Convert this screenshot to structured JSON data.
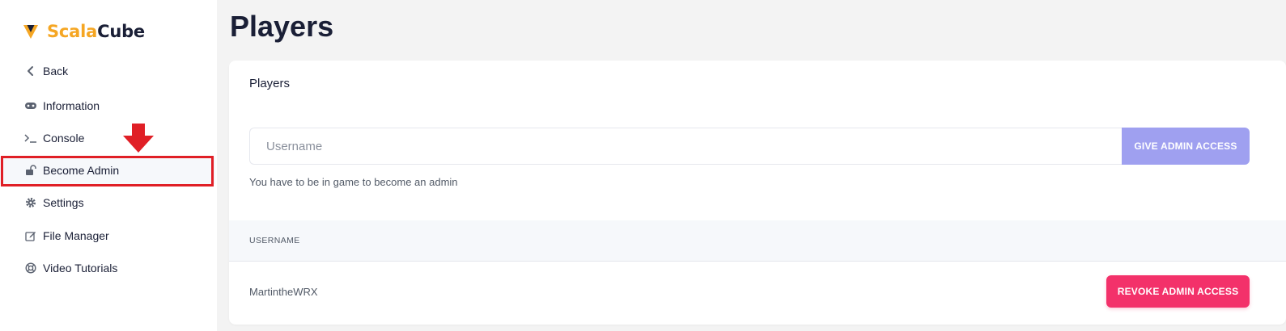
{
  "brand": {
    "part1": "Scala",
    "part2": "Cube",
    "color_scala": "#f5a623",
    "color_cube": "#1a1f36"
  },
  "sidebar": {
    "items": [
      {
        "label": "Back",
        "icon": "chevron-left-icon"
      },
      {
        "label": "Information",
        "icon": "gamepad-icon"
      },
      {
        "label": "Console",
        "icon": "terminal-icon"
      },
      {
        "label": "Become Admin",
        "icon": "unlock-icon"
      },
      {
        "label": "Settings",
        "icon": "gear-icon"
      },
      {
        "label": "File Manager",
        "icon": "edit-icon"
      },
      {
        "label": "Video Tutorials",
        "icon": "lifebuoy-icon"
      }
    ],
    "active_index": 3
  },
  "annotation": {
    "color": "#e01f26"
  },
  "page": {
    "title": "Players"
  },
  "card": {
    "title": "Players",
    "input_placeholder": "Username",
    "give_button": "GIVE ADMIN ACCESS",
    "hint": "You have to be in game to become an admin",
    "table": {
      "column_username": "USERNAME",
      "rows": [
        {
          "username": "MartintheWRX",
          "action": "REVOKE ADMIN ACCESS"
        }
      ]
    }
  },
  "colors": {
    "give_button": "#9fa0f0",
    "revoke_button": "#f3316a"
  }
}
